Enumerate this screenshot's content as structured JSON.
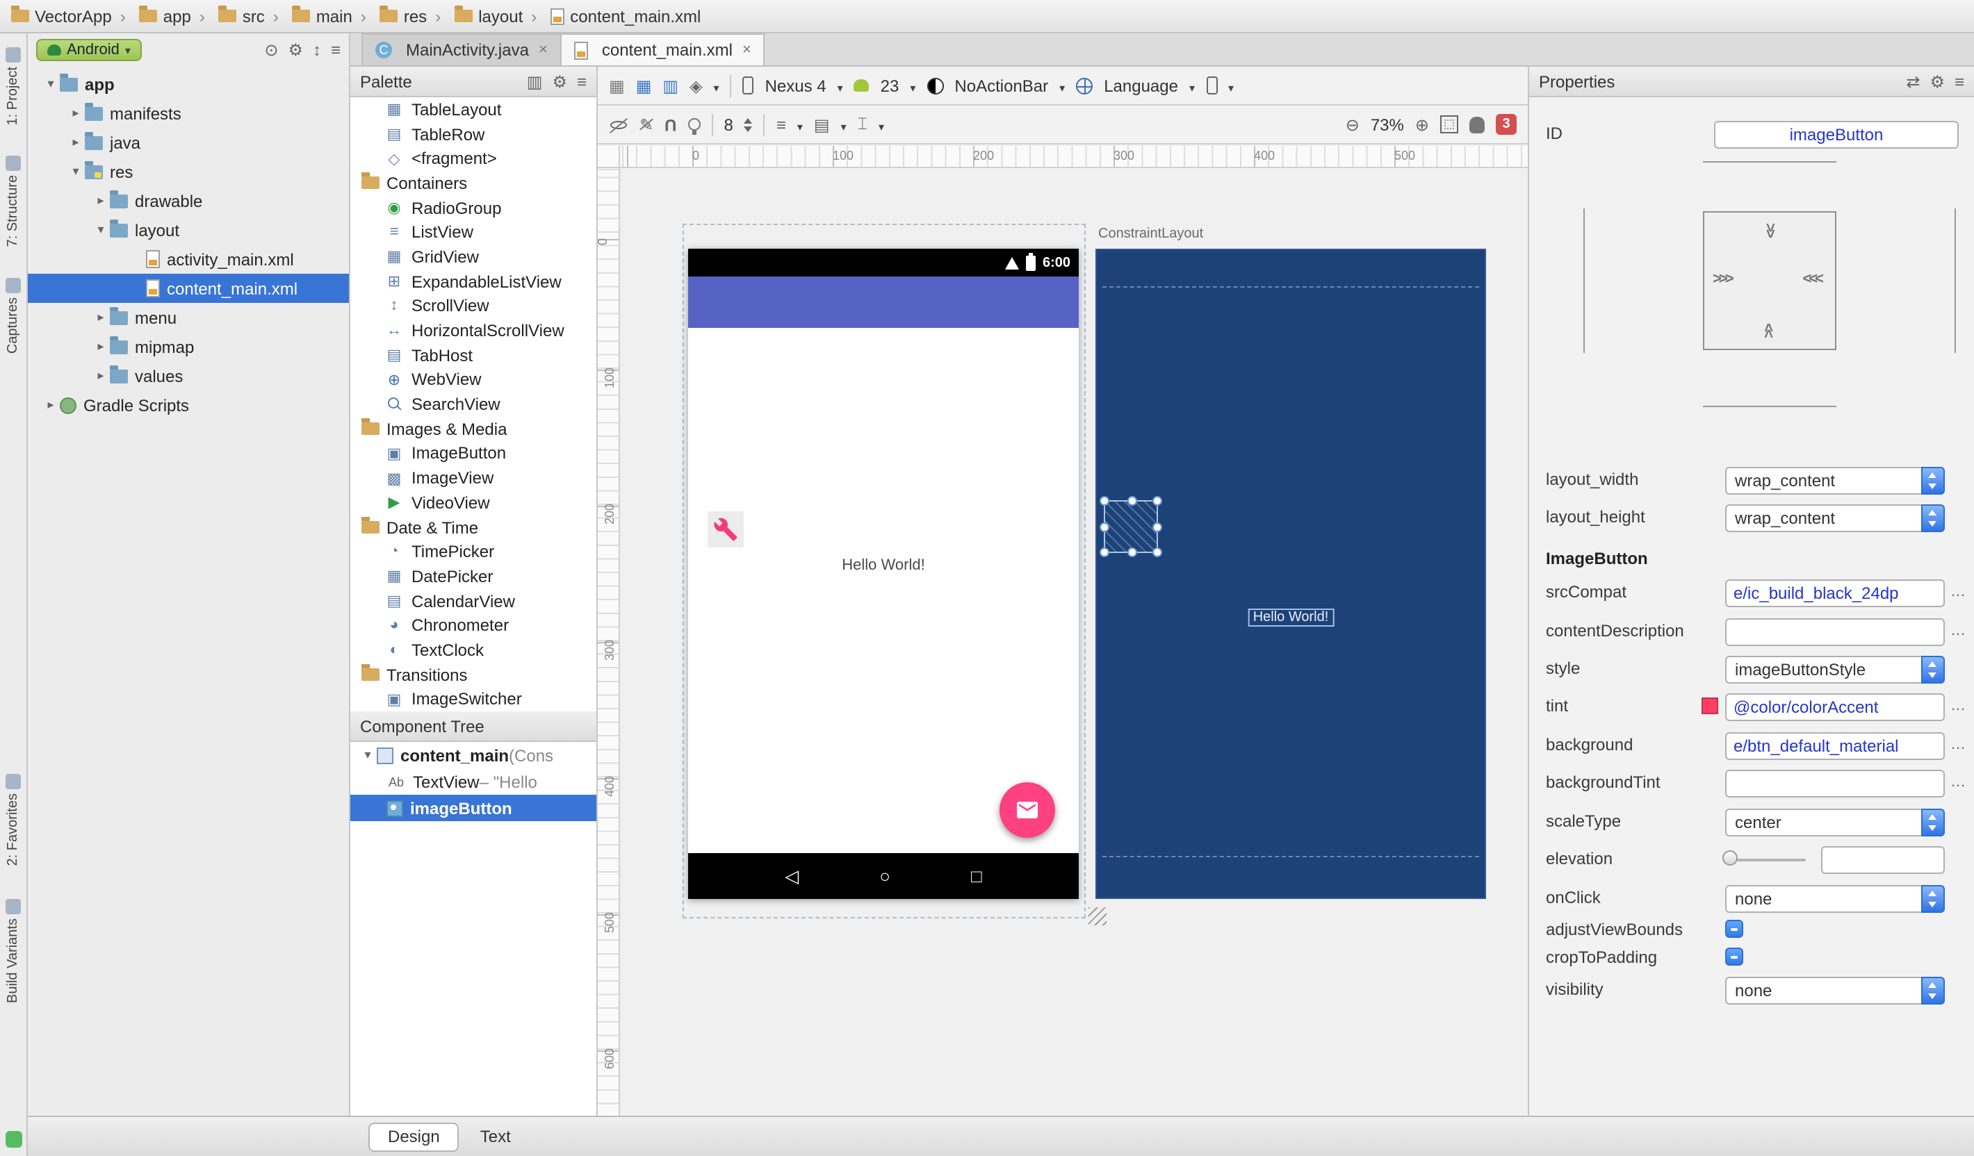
{
  "colors": {
    "accent": "#ff4081",
    "appbar": "#5663c5",
    "blueprint_bg": "#1d4278",
    "selection_blue": "#3875d6",
    "error_red": "#d64f4f",
    "android_green": "#a4c639"
  },
  "breadcrumb": {
    "items": [
      {
        "label": "VectorApp",
        "icon": "bc-folder"
      },
      {
        "label": "app",
        "icon": "bc-folder"
      },
      {
        "label": "src",
        "icon": "bc-folder"
      },
      {
        "label": "main",
        "icon": "bc-folder"
      },
      {
        "label": "res",
        "icon": "bc-folder"
      },
      {
        "label": "layout",
        "icon": "bc-folder"
      },
      {
        "label": "content_main.xml",
        "icon": "bc-xml"
      }
    ]
  },
  "tool_window_bar": {
    "top": [
      "1: Project",
      "7: Structure",
      "Captures"
    ],
    "bottom": [
      "2: Favorites",
      "Build Variants"
    ]
  },
  "project_panel": {
    "view_selector": "Android",
    "tree": [
      {
        "label": "app",
        "ind": "ind0",
        "arrow": "arr-open",
        "icon": "ic-folder",
        "emph": "bold"
      },
      {
        "label": "manifests",
        "ind": "ind1",
        "arrow": "arr-closed",
        "icon": "ic-folder"
      },
      {
        "label": "java",
        "ind": "ind1",
        "arrow": "arr-closed",
        "icon": "ic-folder"
      },
      {
        "label": "res",
        "ind": "ind1",
        "arrow": "arr-open",
        "icon": "ic-res"
      },
      {
        "label": "drawable",
        "ind": "ind2",
        "arrow": "arr-closed",
        "icon": "ic-folder"
      },
      {
        "label": "layout",
        "ind": "ind2",
        "arrow": "arr-open",
        "icon": "ic-folder"
      },
      {
        "label": "activity_main.xml",
        "ind": "ind3",
        "arrow": "arr-none",
        "icon": "ic-xml"
      },
      {
        "label": "content_main.xml",
        "ind": "ind3",
        "arrow": "arr-none",
        "icon": "ic-xml",
        "state": "selected"
      },
      {
        "label": "menu",
        "ind": "ind2",
        "arrow": "arr-closed",
        "icon": "ic-folder"
      },
      {
        "label": "mipmap",
        "ind": "ind2",
        "arrow": "arr-closed",
        "icon": "ic-folder"
      },
      {
        "label": "values",
        "ind": "ind2",
        "arrow": "arr-closed",
        "icon": "ic-folder"
      },
      {
        "label": "Gradle Scripts",
        "ind": "ind0",
        "arrow": "arr-closed",
        "icon": "ic-gradle"
      }
    ]
  },
  "editor_tabs": [
    {
      "label": "MainActivity.java",
      "icon": "ic-class",
      "close": "×"
    },
    {
      "label": "content_main.xml",
      "icon": "ic-xml",
      "close": "×",
      "state": "active"
    }
  ],
  "palette": {
    "title": "Palette",
    "items": [
      {
        "label": "TableLayout",
        "icon": "pi-tablelayout"
      },
      {
        "label": "TableRow",
        "icon": "pi-tablerow"
      },
      {
        "label": "<fragment>",
        "icon": "pi-fragment"
      },
      {
        "label": "Containers",
        "icon": "pi-section",
        "kind": "k-section"
      },
      {
        "label": "RadioGroup",
        "icon": "pi-radiogroup"
      },
      {
        "label": "ListView",
        "icon": "pi-listview"
      },
      {
        "label": "GridView",
        "icon": "pi-gridview"
      },
      {
        "label": "ExpandableListView",
        "icon": "pi-expandable"
      },
      {
        "label": "ScrollView",
        "icon": "pi-scrollview"
      },
      {
        "label": "HorizontalScrollView",
        "icon": "pi-hscrollview"
      },
      {
        "label": "TabHost",
        "icon": "pi-tabhost"
      },
      {
        "label": "WebView",
        "icon": "pi-webview"
      },
      {
        "label": "SearchView",
        "icon": "pi-searchview"
      },
      {
        "label": "Images & Media",
        "icon": "pi-section",
        "kind": "k-section"
      },
      {
        "label": "ImageButton",
        "icon": "pi-imagebutton"
      },
      {
        "label": "ImageView",
        "icon": "pi-imageview"
      },
      {
        "label": "VideoView",
        "icon": "pi-videoview"
      },
      {
        "label": "Date & Time",
        "icon": "pi-section",
        "kind": "k-section"
      },
      {
        "label": "TimePicker",
        "icon": "pi-timepicker"
      },
      {
        "label": "DatePicker",
        "icon": "pi-datepicker"
      },
      {
        "label": "CalendarView",
        "icon": "pi-calendarview"
      },
      {
        "label": "Chronometer",
        "icon": "pi-chronometer"
      },
      {
        "label": "TextClock",
        "icon": "pi-textclock"
      },
      {
        "label": "Transitions",
        "icon": "pi-section",
        "kind": "k-section"
      },
      {
        "label": "ImageSwitcher",
        "icon": "pi-imageswitcher"
      }
    ]
  },
  "component_tree": {
    "title": "Component Tree",
    "rows": [
      {
        "name": "content_main",
        "suffix": " (Cons"
      },
      {
        "name": "TextView",
        "suffix": " – \"Hello"
      },
      {
        "name": "imageButton",
        "suffix": ""
      }
    ]
  },
  "design_toolbar": {
    "device": "Nexus 4",
    "api": "23",
    "theme": "NoActionBar",
    "language": "Language",
    "grid": "8",
    "zoom": "73%",
    "errors": "3",
    "icons": [
      "design-surface-icon",
      "blueprint-surface-icon",
      "both-surfaces-icon",
      "orientation-diamond-icon",
      "device-icon",
      "android-version-icon",
      "theme-icon",
      "language-globe-icon",
      "rotate-device-icon",
      "hide-constraints-icon",
      "autoconnect-off-icon",
      "magnet-icon",
      "infer-constraints-icon",
      "zoom-out-icon",
      "zoom-in-icon",
      "zoom-fit-icon",
      "pan-icon"
    ]
  },
  "canvas": {
    "ruler_h": [
      "0",
      "100",
      "200",
      "300",
      "400",
      "500"
    ],
    "ruler_v": [
      "0",
      "100",
      "200",
      "300",
      "400",
      "500",
      "600"
    ],
    "design": {
      "clock": "6:00",
      "hello": "Hello World!"
    },
    "blueprint": {
      "label": "ConstraintLayout",
      "hello": "Hello World!"
    }
  },
  "properties": {
    "title": "Properties",
    "id_label": "ID",
    "id_value": "imageButton",
    "rows": {
      "layout_width": {
        "label": "layout_width",
        "value": "wrap_content"
      },
      "layout_height": {
        "label": "layout_height",
        "value": "wrap_content"
      },
      "section": "ImageButton",
      "srcCompat": {
        "label": "srcCompat",
        "value": "e/ic_build_black_24dp",
        "more": "…"
      },
      "contentDescription": {
        "label": "contentDescription",
        "value": "",
        "more": "…"
      },
      "style": {
        "label": "style",
        "value": "imageButtonStyle"
      },
      "tint": {
        "label": "tint",
        "value": "@color/colorAccent",
        "more": "…",
        "swatch": "#ff4062"
      },
      "background": {
        "label": "background",
        "value": "e/btn_default_material",
        "more": "…"
      },
      "backgroundTint": {
        "label": "backgroundTint",
        "value": "",
        "more": "…"
      },
      "scaleType": {
        "label": "scaleType",
        "value": "center"
      },
      "elevation": {
        "label": "elevation",
        "value": ""
      },
      "onClick": {
        "label": "onClick",
        "value": "none"
      },
      "adjustViewBounds": {
        "label": "adjustViewBounds"
      },
      "cropToPadding": {
        "label": "cropToPadding"
      },
      "visibility": {
        "label": "visibility",
        "value": "none"
      }
    }
  },
  "bottom_tabs": [
    {
      "label": "Design",
      "state": "active"
    },
    {
      "label": "Text"
    }
  ]
}
